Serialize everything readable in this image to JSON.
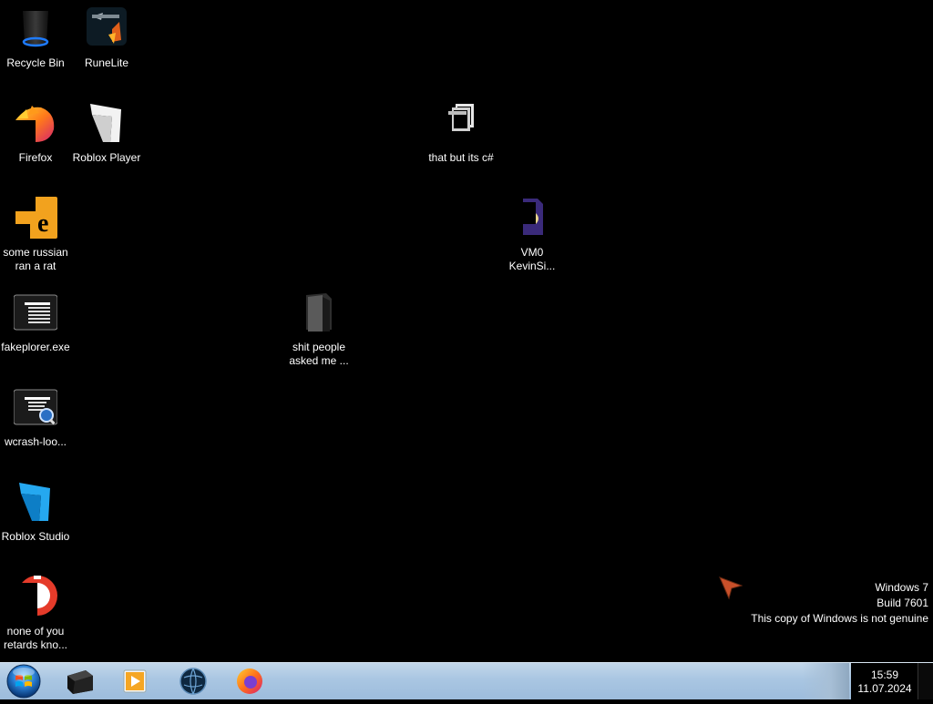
{
  "desktop": {
    "icons": [
      {
        "id": "recycle-bin",
        "label": "Recycle Bin"
      },
      {
        "id": "runelite",
        "label": "RuneLite"
      },
      {
        "id": "firefox",
        "label": "Firefox"
      },
      {
        "id": "roblox-player",
        "label": "Roblox Player"
      },
      {
        "id": "some-russian",
        "label": "some russian\nran a rat"
      },
      {
        "id": "fakeplorer",
        "label": "fakeplorer.exe"
      },
      {
        "id": "wcrash",
        "label": "wcrash-loo..."
      },
      {
        "id": "roblox-studio",
        "label": "Roblox Studio"
      },
      {
        "id": "none-of-you",
        "label": "none of you\nretards kno..."
      },
      {
        "id": "that-but-csharp",
        "label": "that but its c#"
      },
      {
        "id": "vm0",
        "label": "VM0\nKevinSi..."
      },
      {
        "id": "shit-people",
        "label": "shit people\nasked me ..."
      }
    ]
  },
  "watermark": {
    "line1": "Windows 7",
    "line2": "Build 7601",
    "line3": "This copy of Windows is not genuine"
  },
  "taskbar": {
    "pinned": [
      {
        "id": "pinned-explorer",
        "icon": "dark-window-icon"
      },
      {
        "id": "pinned-media-player",
        "icon": "media-player-icon"
      },
      {
        "id": "pinned-globe",
        "icon": "globe-icon"
      },
      {
        "id": "pinned-firefox",
        "icon": "firefox-icon"
      }
    ],
    "clock": {
      "time": "15:59",
      "date": "11.07.2024"
    }
  },
  "colors": {
    "desktop_bg": "#000000",
    "taskbar_top": "#c3d7ea",
    "taskbar_bottom": "#9dbcdc",
    "start_orb": "#2a7fd4"
  }
}
